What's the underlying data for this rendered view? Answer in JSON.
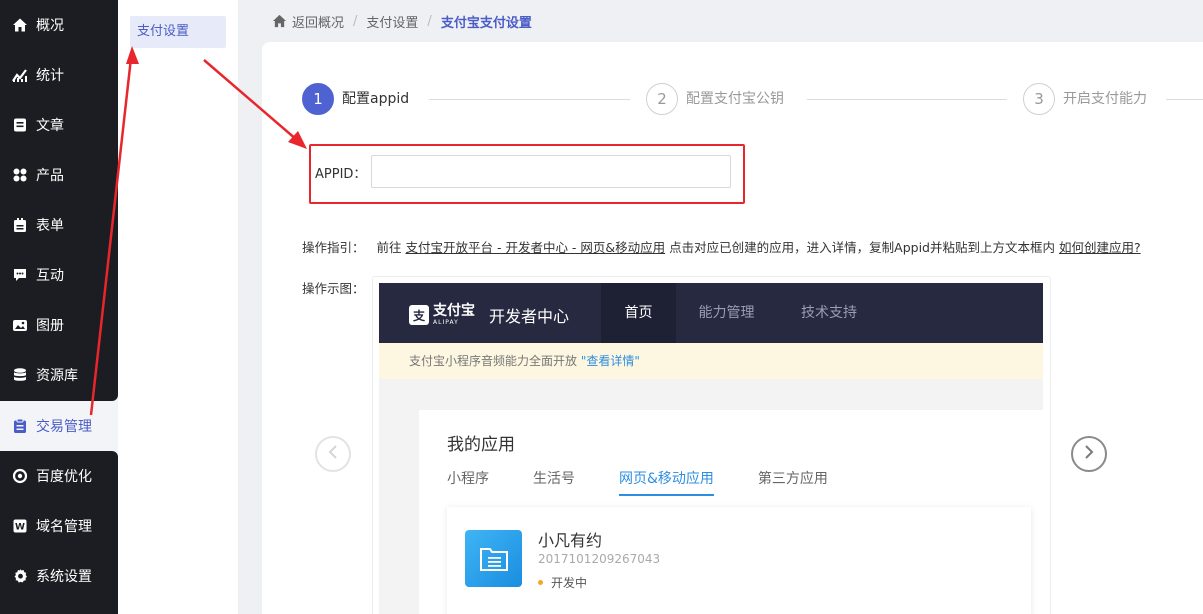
{
  "sidebar": {
    "items": [
      {
        "label": "概况",
        "icon": "home-icon"
      },
      {
        "label": "统计",
        "icon": "chart-icon"
      },
      {
        "label": "文章",
        "icon": "article-icon"
      },
      {
        "label": "产品",
        "icon": "grid-icon"
      },
      {
        "label": "表单",
        "icon": "form-icon"
      },
      {
        "label": "互动",
        "icon": "chat-icon"
      },
      {
        "label": "图册",
        "icon": "image-icon"
      },
      {
        "label": "资源库",
        "icon": "database-icon"
      },
      {
        "label": "交易管理",
        "icon": "clipboard-icon"
      },
      {
        "label": "百度优化",
        "icon": "target-icon"
      },
      {
        "label": "域名管理",
        "icon": "domain-icon"
      },
      {
        "label": "系统设置",
        "icon": "gear-icon"
      }
    ],
    "active_index": 8
  },
  "submenu": {
    "items": [
      {
        "label": "支付设置"
      }
    ]
  },
  "breadcrumb": {
    "back": "返回概况",
    "parent": "支付设置",
    "current": "支付宝支付设置"
  },
  "steps": [
    {
      "num": "1",
      "label": "配置appid"
    },
    {
      "num": "2",
      "label": "配置支付宝公钥"
    },
    {
      "num": "3",
      "label": "开启支付能力"
    }
  ],
  "form": {
    "appid_label": "APPID：",
    "appid_value": ""
  },
  "guide": {
    "label": "操作指引：",
    "prefix": "前往",
    "link_text": "支付宝开放平台 - 开发者中心 - 网页&移动应用",
    "middle": "点击对应已创建的应用，进入详情，复制Appid并粘贴到上方文本框内",
    "help_link": "如何创建应用?"
  },
  "demo": {
    "label": "操作示图：",
    "screenshot": {
      "brand_cn": "支付宝",
      "brand_en": "ALIPAY",
      "dev_center": "开发者中心",
      "nav_tabs": [
        "首页",
        "能力管理",
        "技术支持"
      ],
      "banner_text": "支付宝小程序音频能力全面开放",
      "banner_link": "\"查看详情\"",
      "panel_title": "我的应用",
      "app_tabs": [
        "小程序",
        "生活号",
        "网页&移动应用",
        "第三方应用"
      ],
      "app_name": "小凡有约",
      "app_id": "2017101209267043",
      "app_status": "开发中"
    }
  },
  "colors": {
    "accent": "#4f62d2",
    "sidebar_bg": "#1c1d22",
    "annotation_red": "#e8262b",
    "alipay_blue": "#2f8ee0"
  }
}
